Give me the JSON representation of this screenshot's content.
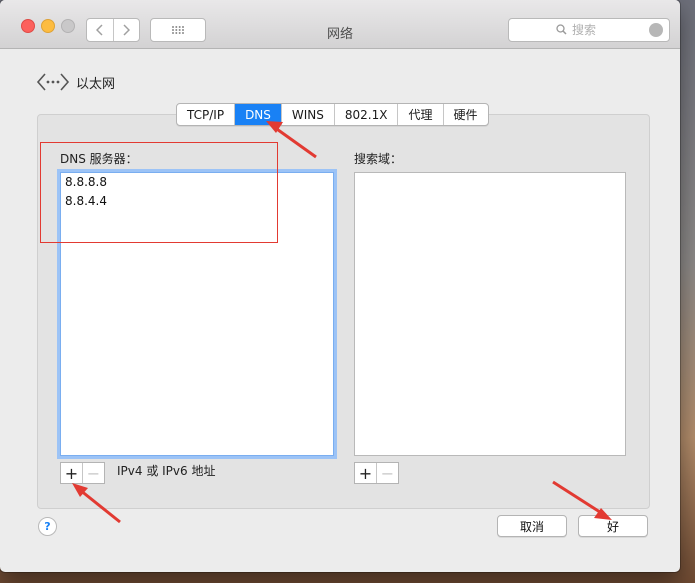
{
  "window": {
    "title": "网络",
    "search_placeholder": "搜索"
  },
  "breadcrumb": {
    "label": "以太网"
  },
  "tabs": [
    {
      "label": "TCP/IP",
      "active": false
    },
    {
      "label": "DNS",
      "active": true
    },
    {
      "label": "WINS",
      "active": false
    },
    {
      "label": "802.1X",
      "active": false
    },
    {
      "label": "代理",
      "active": false
    },
    {
      "label": "硬件",
      "active": false
    }
  ],
  "dns": {
    "label": "DNS 服务器：",
    "servers": [
      "8.8.8.8",
      "8.8.4.4"
    ],
    "hint": "IPv4 或 IPv6 地址"
  },
  "search_domains": {
    "label": "搜索域：",
    "items": []
  },
  "stepper": {
    "plus": "+",
    "minus": "−"
  },
  "help": "?",
  "buttons": {
    "cancel": "取消",
    "ok": "好"
  },
  "colors": {
    "accent": "#1981f5",
    "annotation": "#e23a32"
  },
  "icons": {
    "close": "close-icon",
    "minimize": "minimize-icon",
    "zoom": "zoom-icon",
    "back": "chevron-left-icon",
    "forward": "chevron-right-icon",
    "grid": "grid-icon",
    "search": "search-icon",
    "network": "ethernet-icon"
  }
}
